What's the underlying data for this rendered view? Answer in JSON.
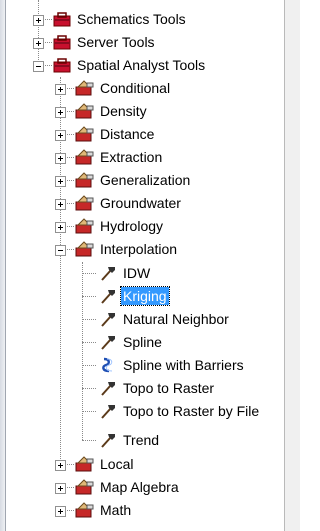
{
  "tree": {
    "top": [
      {
        "label": "Schematics Tools",
        "expanded": false
      },
      {
        "label": "Server Tools",
        "expanded": false
      },
      {
        "label": "Spatial Analyst Tools",
        "expanded": true
      }
    ],
    "spatial_analyst": [
      {
        "label": "Conditional",
        "expanded": false
      },
      {
        "label": "Density",
        "expanded": false
      },
      {
        "label": "Distance",
        "expanded": false
      },
      {
        "label": "Extraction",
        "expanded": false
      },
      {
        "label": "Generalization",
        "expanded": false
      },
      {
        "label": "Groundwater",
        "expanded": false
      },
      {
        "label": "Hydrology",
        "expanded": false
      },
      {
        "label": "Interpolation",
        "expanded": true
      }
    ],
    "interpolation": [
      {
        "label": "IDW",
        "icon": "hammer-icon",
        "selected": false
      },
      {
        "label": "Kriging",
        "icon": "hammer-icon",
        "selected": true
      },
      {
        "label": "Natural Neighbor",
        "icon": "hammer-icon",
        "selected": false
      },
      {
        "label": "Spline",
        "icon": "hammer-icon",
        "selected": false
      },
      {
        "label": "Spline with Barriers",
        "icon": "script-icon",
        "selected": false
      },
      {
        "label": "Topo to Raster",
        "icon": "hammer-icon",
        "selected": false
      },
      {
        "label": "Topo to Raster by File",
        "icon": "hammer-icon",
        "selected": false
      },
      {
        "label": "Trend",
        "icon": "hammer-icon",
        "selected": false
      }
    ],
    "after": [
      {
        "label": "Local",
        "expanded": false
      },
      {
        "label": "Map Algebra",
        "expanded": false
      },
      {
        "label": "Math",
        "expanded": false
      }
    ]
  },
  "colors": {
    "selection": "#3399ff",
    "toolbox_red": "#c8102e",
    "toolset_red": "#c62828",
    "toolset_tan": "#e0b878"
  }
}
